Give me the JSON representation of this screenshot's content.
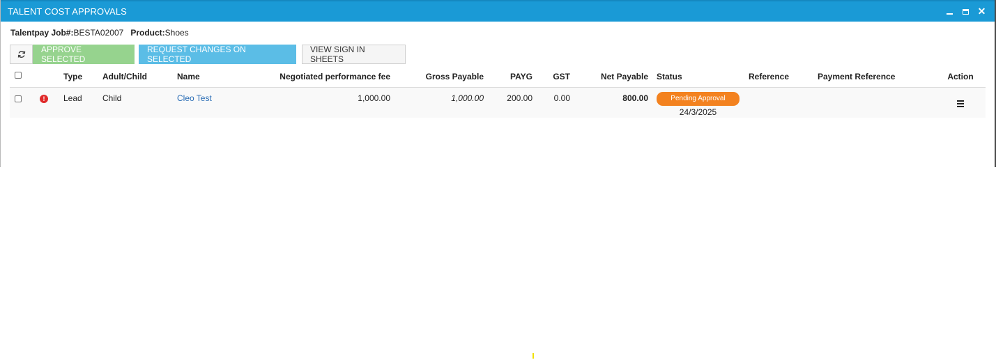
{
  "window": {
    "title": "TALENT COST APPROVALS",
    "controls": {
      "minimize": "minimize-icon",
      "maximize": "maximize-icon",
      "close": "close-icon"
    }
  },
  "job": {
    "job_label": "Talentpay Job#:",
    "job_value": "BESTA02007",
    "product_label": "Product:",
    "product_value": "Shoes"
  },
  "toolbar": {
    "refresh_icon": "refresh-icon",
    "approve_label": "APPROVE SELECTED",
    "request_label": "REQUEST CHANGES ON SELECTED",
    "sign_label": "VIEW SIGN IN SHEETS"
  },
  "table": {
    "headers": {
      "type": "Type",
      "adult_child": "Adult/Child",
      "name": "Name",
      "fee": "Negotiated performance fee",
      "gross": "Gross Payable",
      "payg": "PAYG",
      "gst": "GST",
      "net": "Net Payable",
      "status": "Status",
      "reference": "Reference",
      "payment_reference": "Payment Reference",
      "action": "Action"
    },
    "rows": [
      {
        "type": "Lead",
        "adult_child": "Child",
        "name": "Cleo Test",
        "fee": "1,000.00",
        "gross": "1,000.00",
        "payg": "200.00",
        "gst": "0.00",
        "net": "800.00",
        "status": "Pending Approval",
        "status_date": "24/3/2025",
        "reference": "",
        "payment_reference": ""
      }
    ]
  },
  "colors": {
    "titlebar": "#1a9ad6",
    "approve": "#96d38e",
    "request": "#5bbde6",
    "status_pending": "#f3821f",
    "alert": "#e02a2a"
  }
}
